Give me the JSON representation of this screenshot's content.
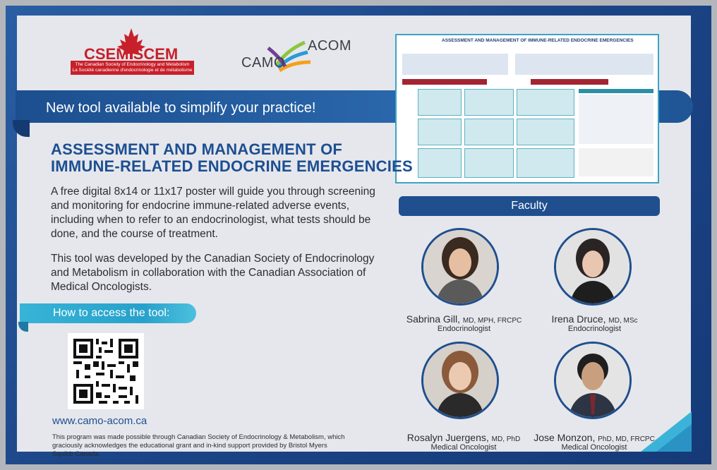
{
  "csem": {
    "name": "CSEM SCEM",
    "line1": "The Canadian Society of Endocrinology and Metabolism",
    "line2": "La Société canadienne d'endocrinologie et de métabolisme"
  },
  "camo": {
    "left": "CAMO",
    "right": "ACOM"
  },
  "banner": {
    "text": "New tool available to simplify your practice!"
  },
  "poster": {
    "title": "ASSESSMENT AND MANAGEMENT OF IMMUNE-RELATED ENDOCRINE EMERGENCIES"
  },
  "headline": {
    "line1": "ASSESSMENT AND MANAGEMENT OF",
    "line2": "IMMUNE-RELATED ENDOCRINE EMERGENCIES"
  },
  "body": {
    "p1": "A free digital 8x14 or 11x17 poster will guide you through screening and monitoring for endocrine immune-related adverse events, including when to refer to an endocrinologist, what tests should be done, and the course of treatment.",
    "p2": "This tool was developed by the Canadian Society of Endocrinology and Metabolism in collaboration with the Canadian Association of Medical Oncologists."
  },
  "access": {
    "label": "How to access the tool:"
  },
  "url": "www.camo-acom.ca",
  "footnote": "This program was made possible through Canadian Society of Endocrinology & Metabolism, which graciously acknowledges the educational grant and in-kind support provided by Bristol Myers Squibb Canada.",
  "faculty": {
    "label": "Faculty",
    "people": [
      {
        "name": "Sabrina Gill,",
        "creds": "MD, MPH, FRCPC",
        "role": "Endocrinologist"
      },
      {
        "name": "Irena Druce,",
        "creds": "MD, MSc",
        "role": "Endocrinologist"
      },
      {
        "name": "Rosalyn Juergens,",
        "creds": "MD, PhD",
        "role": "Medical Oncologist"
      },
      {
        "name": "Jose Monzon,",
        "creds": "PhD, MD, FRCPC",
        "role": "Medical Oncologist"
      }
    ]
  },
  "colors": {
    "navy": "#1f4f8e",
    "teal": "#27a1cb",
    "red": "#c8202a"
  }
}
